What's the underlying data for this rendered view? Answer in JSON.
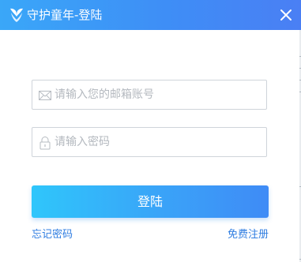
{
  "window": {
    "title": "守护童年-登陆",
    "logo_icon": "heart-leaf-logo",
    "close_icon": "close-icon"
  },
  "form": {
    "email": {
      "icon": "envelope-icon",
      "placeholder": "请输入您的邮箱账号",
      "value": ""
    },
    "password": {
      "icon": "lock-icon",
      "placeholder": "请输入密码",
      "value": ""
    },
    "login_label": "登陆"
  },
  "links": {
    "forgot_password": "忘记密码",
    "register": "免费注册"
  },
  "colors": {
    "titlebar_start": "#3aa7f8",
    "titlebar_end": "#4a7ff4",
    "button_start": "#2fc6fb",
    "button_end": "#3f8bf6",
    "link": "#2f7de1"
  }
}
